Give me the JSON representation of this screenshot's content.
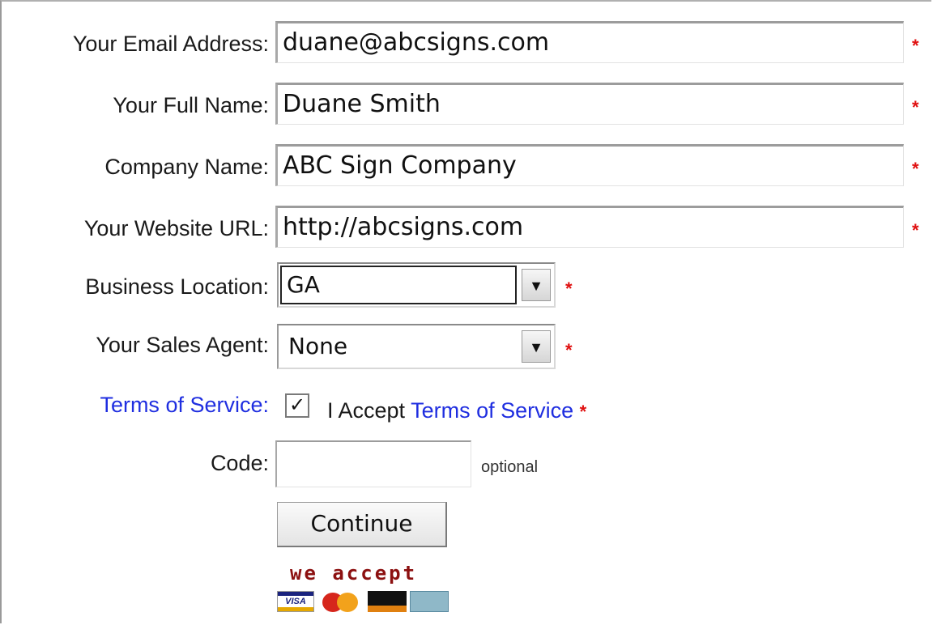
{
  "form": {
    "email": {
      "label": "Your Email Address:",
      "value": "duane@abcsigns.com",
      "required": "*"
    },
    "full_name": {
      "label": "Your Full Name:",
      "value": "Duane Smith",
      "required": "*"
    },
    "company": {
      "label": "Company Name:",
      "value": "ABC Sign Company",
      "required": "*"
    },
    "website": {
      "label": "Your Website URL:",
      "value": "http://abcsigns.com",
      "required": "*"
    },
    "location": {
      "label": "Business Location:",
      "selected": "GA",
      "required": "*"
    },
    "agent": {
      "label": "Your Sales Agent:",
      "selected": "None",
      "required": "*"
    },
    "terms": {
      "label": "Terms of Service:",
      "checked": true,
      "checkmark": "✓",
      "accept_prefix": "I Accept ",
      "accept_link": "Terms of Service",
      "required": "*"
    },
    "code": {
      "label": "Code:",
      "value": "",
      "hint": "optional"
    },
    "continue_label": "Continue"
  },
  "payment": {
    "heading": "we accept",
    "cards": [
      "visa-icon",
      "mastercard-icon",
      "discover-icon",
      "amex-icon"
    ],
    "visa_text": "VISA"
  },
  "colors": {
    "required": "#e01010",
    "link": "#1f2ee0",
    "we_accept": "#8c1010"
  }
}
